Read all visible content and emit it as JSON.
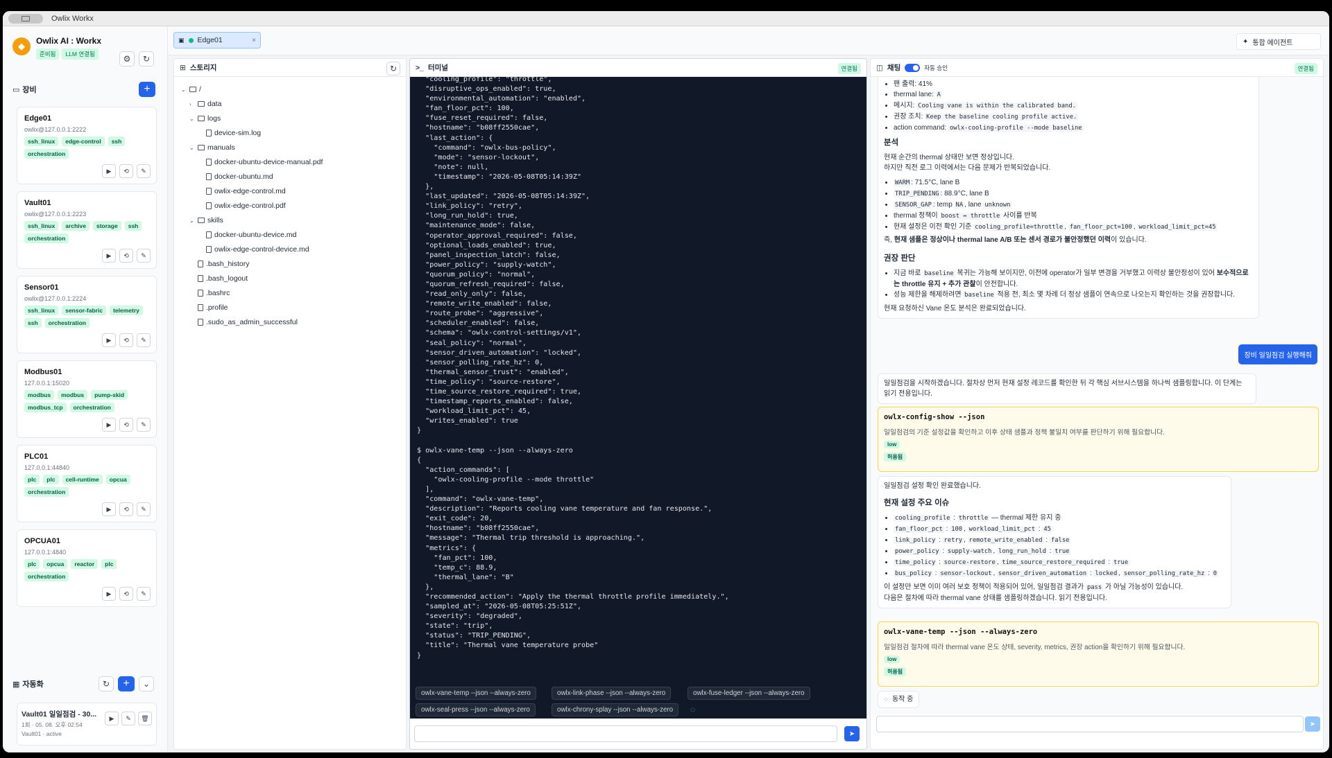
{
  "window": {
    "title": "Owlix Workx"
  },
  "brand": {
    "name": "Owlix AI : Workx",
    "badge_ready": "준비됨",
    "badge_llm": "LLM 연결됨"
  },
  "devices": {
    "title": "장비",
    "items": [
      {
        "name": "Edge01",
        "addr": "owlix@127.0.0.1:2222",
        "tags": [
          "ssh_linux",
          "edge-control",
          "ssh",
          "orchestration"
        ]
      },
      {
        "name": "Vault01",
        "addr": "owlix@127.0.0.1:2223",
        "tags": [
          "ssh_linux",
          "archive",
          "storage",
          "ssh",
          "orchestration"
        ]
      },
      {
        "name": "Sensor01",
        "addr": "owlix@127.0.0.1:2224",
        "tags": [
          "ssh_linux",
          "sensor-fabric",
          "telemetry",
          "ssh",
          "orchestration"
        ]
      },
      {
        "name": "Modbus01",
        "addr": "127.0.0.1:15020",
        "tags": [
          "modbus",
          "modbus",
          "pump-skid",
          "modbus_tcp",
          "orchestration"
        ]
      },
      {
        "name": "PLC01",
        "addr": "127.0.0.1:44840",
        "tags": [
          "plc",
          "plc",
          "cell-runtime",
          "opcua",
          "orchestration"
        ]
      },
      {
        "name": "OPCUA01",
        "addr": "127.0.0.1:4840",
        "tags": [
          "plc",
          "opcua",
          "reactor",
          "plc",
          "orchestration"
        ]
      }
    ]
  },
  "automation": {
    "title": "자동화",
    "item": {
      "name": "Vault01 일일점검 - 30...",
      "meta": "1회 · 05. 08. 오후 02:54",
      "status": "Vault01 · active"
    }
  },
  "tab": {
    "label": "Edge01",
    "close": "×"
  },
  "agent_button": "통합 에이전트",
  "storage": {
    "title": "스토리지",
    "tree": [
      {
        "label": "/",
        "type": "folder",
        "depth": 0,
        "open": true
      },
      {
        "label": "data",
        "type": "folder",
        "depth": 1,
        "open": false
      },
      {
        "label": "logs",
        "type": "folder",
        "depth": 1,
        "open": true
      },
      {
        "label": "device-sim.log",
        "type": "file",
        "depth": 2
      },
      {
        "label": "manuals",
        "type": "folder",
        "depth": 1,
        "open": true
      },
      {
        "label": "docker-ubuntu-device-manual.pdf",
        "type": "file",
        "depth": 2
      },
      {
        "label": "docker-ubuntu.md",
        "type": "file",
        "depth": 2
      },
      {
        "label": "owlix-edge-control.md",
        "type": "file",
        "depth": 2
      },
      {
        "label": "owlix-edge-control.pdf",
        "type": "file",
        "depth": 2
      },
      {
        "label": "skills",
        "type": "folder",
        "depth": 1,
        "open": true
      },
      {
        "label": "docker-ubuntu-device.md",
        "type": "file",
        "depth": 2
      },
      {
        "label": "owlix-edge-control-device.md",
        "type": "file",
        "depth": 2
      },
      {
        "label": ".bash_history",
        "type": "file",
        "depth": 1
      },
      {
        "label": ".bash_logout",
        "type": "file",
        "depth": 1
      },
      {
        "label": ".bashrc",
        "type": "file",
        "depth": 1
      },
      {
        "label": ".profile",
        "type": "file",
        "depth": 1
      },
      {
        "label": ".sudo_as_admin_successful",
        "type": "file",
        "depth": 1
      }
    ]
  },
  "terminal": {
    "title": "터미널",
    "status": "연결됨",
    "output": "  \"cooling_profile\": \"throttle\",\n  \"disruptive_ops_enabled\": true,\n  \"environmental_automation\": \"enabled\",\n  \"fan_floor_pct\": 100,\n  \"fuse_reset_required\": false,\n  \"hostname\": \"b08ff2550cae\",\n  \"last_action\": {\n    \"command\": \"owlx-bus-policy\",\n    \"mode\": \"sensor-lockout\",\n    \"note\": null,\n    \"timestamp\": \"2026-05-08T05:14:39Z\"\n  },\n  \"last_updated\": \"2026-05-08T05:14:39Z\",\n  \"link_policy\": \"retry\",\n  \"long_run_hold\": true,\n  \"maintenance_mode\": false,\n  \"operator_approval_required\": false,\n  \"optional_loads_enabled\": true,\n  \"panel_inspection_latch\": false,\n  \"power_policy\": \"supply-watch\",\n  \"quorum_policy\": \"normal\",\n  \"quorum_refresh_required\": false,\n  \"read_only_only\": false,\n  \"remote_write_enabled\": false,\n  \"route_probe\": \"aggressive\",\n  \"scheduler_enabled\": false,\n  \"schema\": \"owlx-control-settings/v1\",\n  \"seal_policy\": \"normal\",\n  \"sensor_driven_automation\": \"locked\",\n  \"sensor_polling_rate_hz\": 0,\n  \"thermal_sensor_trust\": \"enabled\",\n  \"time_policy\": \"source-restore\",\n  \"time_source_restore_required\": true,\n  \"timestamp_reports_enabled\": false,\n  \"workload_limit_pct\": 45,\n  \"writes_enabled\": true\n}\n\n$ owlx-vane-temp --json --always-zero\n{\n  \"action_commands\": [\n    \"owlx-cooling-profile --mode throttle\"\n  ],\n  \"command\": \"owlx-vane-temp\",\n  \"description\": \"Reports cooling vane temperature and fan response.\",\n  \"exit_code\": 20,\n  \"hostname\": \"b08ff2550cae\",\n  \"message\": \"Thermal trip threshold is approaching.\",\n  \"metrics\": {\n    \"fan_pct\": 100,\n    \"temp_c\": 88.9,\n    \"thermal_lane\": \"B\"\n  },\n  \"recommended_action\": \"Apply the thermal throttle profile immediately.\",\n  \"sampled_at\": \"2026-05-08T05:25:51Z\",\n  \"severity\": \"degraded\",\n  \"state\": \"trip\",\n  \"status\": \"TRIP_PENDING\",\n  \"title\": \"Thermal vane temperature probe\"\n}",
    "suggestions": [
      "owlx-vane-temp --json --always-zero",
      "owlx-link-phase --json --always-zero",
      "owlx-fuse-ledger --json --always-zero",
      "owlx-seal-press --json --always-zero",
      "owlx-chrony-splay --json --always-zero"
    ]
  },
  "chat": {
    "title": "채팅",
    "auto_approve": "자동 승인",
    "status": "연결됨",
    "m1_items": [
      "팬 출력: 41%",
      "thermal lane: ",
      "메시지: ",
      "권장 조치: ",
      "action command: "
    ],
    "m1_codes": [
      "A",
      "Cooling vane is within the calibrated band.",
      "Keep the baseline cooling profile active.",
      "owlx-cooling-profile --mode baseline"
    ],
    "m1_h_analysis": "분석",
    "m1_p1": "현재 순간의 thermal 상태만 보면 정상입니다.",
    "m1_p2": "하지만 직전 로그 이력에서는 다음 문제가 반복되었습니다.",
    "m1_a1": ": 71.5°C, lane B",
    "m1_a2": ": 88.9°C, lane B",
    "m1_a3a": ": temp ",
    "m1_a3b": ", lane ",
    "m1_a4a": "thermal 정책이 ",
    "m1_a4b": " 사이를 반복",
    "m1_a5": "현재 설정은 이전 확인 기준 ",
    "m1_codes2": [
      "WARM",
      "TRIP_PENDING",
      "SENSOR_GAP",
      "NA",
      "unknown",
      "boost ↔ throttle",
      "cooling_profile=throttle",
      "fan_floor_pct=100",
      "workload_limit_pct=45"
    ],
    "m1_p3a": "즉, ",
    "m1_p3b": "현재 샘플은 정상이나 thermal lane A/B 또는 센서 경로가 불안정했던 이력",
    "m1_p3c": "이 있습니다.",
    "m1_h_recommend": "권장 판단",
    "m1_r1a": "지금 바로 ",
    "m1_r1b": " 복귀는 가능해 보이지만, 이전에 operator가 일부 변경을 거부했고 이력상 불안정성이 있어 ",
    "m1_r1c": "보수적으로는 throttle 유지 + 추가 관찰",
    "m1_r1d": "이 안전합니다.",
    "m1_r2a": "성능 제한을 해제하려면 ",
    "m1_r2b": " 적용 전, 최소 몇 차례 더 정상 샘플이 연속으로 나오는지 확인하는 것을 권장합니다.",
    "m1_code_baseline": "baseline",
    "m1_done": "현재 요청하신 Vane 온도 분석은 완료되었습니다.",
    "user_msg": "장비 일일점검 실행해줘",
    "m2": "일일점검을 시작하겠습니다. 절차상 먼저 현재 설정 레코드를 확인한 뒤 각 핵심 서브시스템을 하나씩 샘플링합니다. 이 단계는 읽기 전용입니다.",
    "tool1": {
      "cmd": "owlx-config-show --json",
      "desc": "일일점검의 기준 설정값을 확인하고 이후 상태 샘플과 정책 불일치 여부를 판단하기 위해 필요합니다.",
      "risk": "low",
      "approval": "허용됨"
    },
    "m3_intro": "일일점검 설정 확인 완료했습니다.",
    "m3_h": "현재 설정 주요 이슈",
    "m3_k": [
      "cooling_profile",
      "throttle",
      "fan_floor_pct",
      "100",
      "workload_limit_pct",
      "45",
      "link_policy",
      "retry",
      "remote_write_enabled",
      "false",
      "power_policy",
      "supply-watch",
      "long_run_hold",
      "true",
      "time_policy",
      "source-restore",
      "time_source_restore_required",
      "true",
      "bus_policy",
      "sensor-lockout",
      "sensor_driven_automation",
      "locked",
      "sensor_polling_rate_hz",
      "0"
    ],
    "m3_t1": " — thermal 제한 유지 중",
    "m3_p1a": "이 설정만 보면 이미 여러 보호 정책이 적용되어 있어, 일일점검 결과가 ",
    "m3_p1b": "pass",
    "m3_p1c": " 가 아닐 가능성이 있습니다.",
    "m3_p2": "다음은 절차에 따라 thermal vane 상태를 샘플링하겠습니다. 읽기 전용입니다.",
    "tool2": {
      "cmd": "owlx-vane-temp --json --always-zero",
      "desc": "일일점검 절차에 따라 thermal vane 온도 상태, severity, metrics, 권장 action을 확인하기 위해 필요합니다.",
      "risk": "low",
      "approval": "허용됨"
    },
    "working": "동작 중"
  }
}
